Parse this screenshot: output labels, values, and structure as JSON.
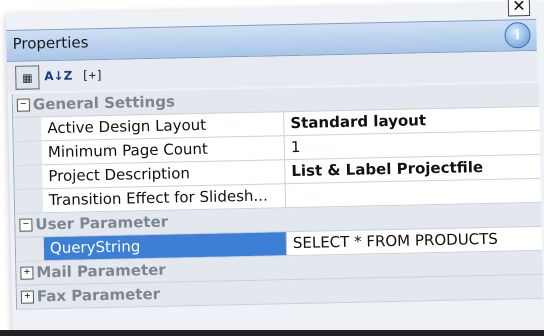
{
  "window": {
    "title": "Properties",
    "close_label": "✕",
    "info_label": "i"
  },
  "toolbar": {
    "categorized_icon": "categorized-view-icon",
    "sort_icon": "sort-az-icon",
    "sort_label": "A↓Z",
    "expand_label": "[+]"
  },
  "grid": {
    "categories": [
      {
        "label": "General Settings",
        "toggle": "−",
        "rows": [
          {
            "name": "Active Design Layout",
            "value": "Standard layout",
            "bold": true
          },
          {
            "name": "Minimum Page Count",
            "value": "1",
            "bold": false
          },
          {
            "name": "Project Description",
            "value": "List & Label Projectfile",
            "bold": true
          },
          {
            "name": "Transition Effect for Slidesh...",
            "value": "",
            "bold": false
          }
        ]
      },
      {
        "label": "User Parameter",
        "toggle": "−",
        "rows": [
          {
            "name": "QueryString",
            "value": "SELECT * FROM PRODUCTS",
            "bold": false,
            "selected": true
          }
        ]
      },
      {
        "label": "Mail Parameter",
        "toggle": "+",
        "rows": []
      },
      {
        "label": "Fax Parameter",
        "toggle": "+",
        "rows": []
      }
    ]
  },
  "colors": {
    "title_bar": "#a9c6e8",
    "selection": "#3c7fd4",
    "category_text": "#7d8592"
  }
}
